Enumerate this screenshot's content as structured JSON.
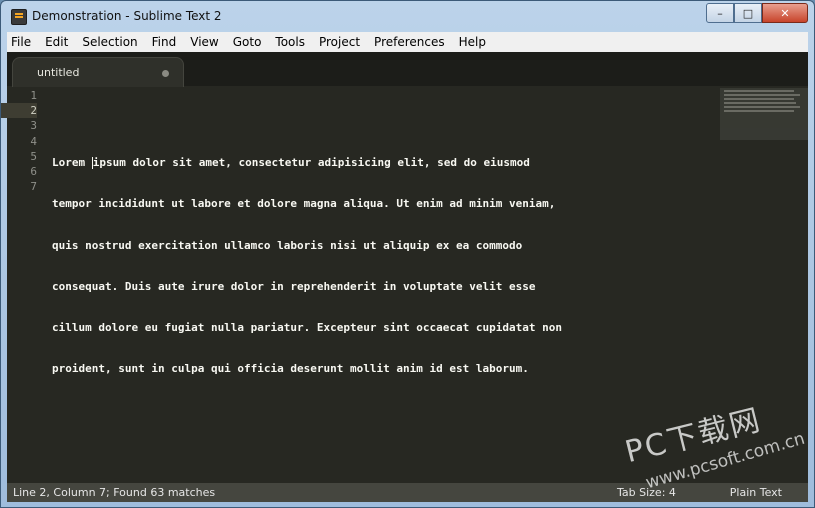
{
  "window": {
    "title": "Demonstration - Sublime Text 2",
    "buttons": {
      "minimize": "–",
      "maximize": "□",
      "close": "✕"
    }
  },
  "menu": [
    "File",
    "Edit",
    "Selection",
    "Find",
    "View",
    "Goto",
    "Tools",
    "Project",
    "Preferences",
    "Help"
  ],
  "tab": {
    "label": "untitled"
  },
  "gutter": [
    "1",
    "2",
    "3",
    "4",
    "5",
    "6",
    "7"
  ],
  "code": {
    "line1": "",
    "line2_pre": "Lorem ",
    "line2_post": "ipsum dolor sit amet, consectetur adipisicing elit, sed do eiusmod",
    "line3": "tempor incididunt ut labore et dolore magna aliqua. Ut enim ad minim veniam,",
    "line4": "quis nostrud exercitation ullamco laboris nisi ut aliquip ex ea commodo",
    "line5": "consequat. Duis aute irure dolor in reprehenderit in voluptate velit esse",
    "line6": "cillum dolore eu fugiat nulla pariatur. Excepteur sint occaecat cupidatat non",
    "line7": "proident, sunt in culpa qui officia deserunt mollit anim id est laborum."
  },
  "status": {
    "left": "Line 2, Column 7; Found 63 matches",
    "tab_size": "Tab Size: 4",
    "syntax": "Plain Text"
  },
  "watermark": {
    "main": "PC下载网",
    "sub": "www.pcsoft.com.cn"
  },
  "colors": {
    "editor_bg": "#272822",
    "text": "#f8f8f2",
    "status_bg": "#45463f"
  }
}
